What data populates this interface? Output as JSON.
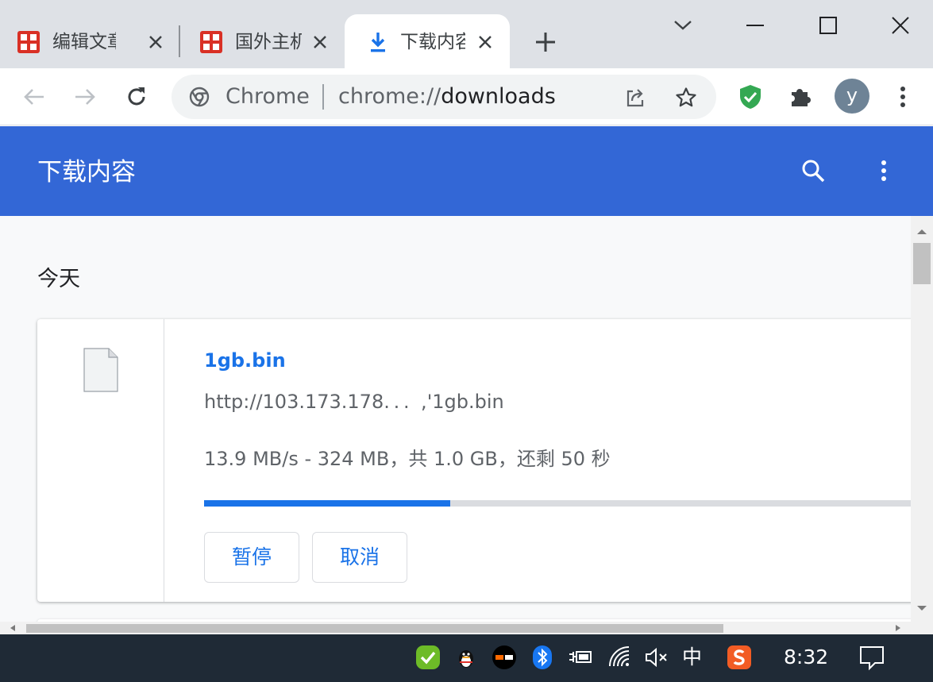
{
  "tabs": [
    {
      "title": "编辑文章",
      "favicon": "red-seal-icon",
      "active": false
    },
    {
      "title": "国外主机",
      "favicon": "red-seal-icon",
      "active": false
    },
    {
      "title": "下载内容",
      "favicon": "download-icon",
      "active": true
    }
  ],
  "omnibox": {
    "site_chip": "Chrome",
    "url_scheme": "chrome://",
    "url_host": "downloads"
  },
  "profile": {
    "initial": "y"
  },
  "downloads_page": {
    "title": "下载内容",
    "section_date": "今天",
    "items": [
      {
        "file_name": "1gb.bin",
        "source_url": "http://103.173.178. . .   ,'1gb.bin",
        "status": "13.9 MB/s - 324 MB，共 1.0 GB，还剩 50 秒",
        "progress": 0.344,
        "pause_label": "暂停",
        "cancel_label": "取消"
      }
    ]
  },
  "colors": {
    "header_blue": "#3367d6",
    "link_blue": "#1a73e8",
    "taskbar": "#1f2a36"
  },
  "taskbar": {
    "ime_label": "中",
    "clock": "8:32"
  }
}
